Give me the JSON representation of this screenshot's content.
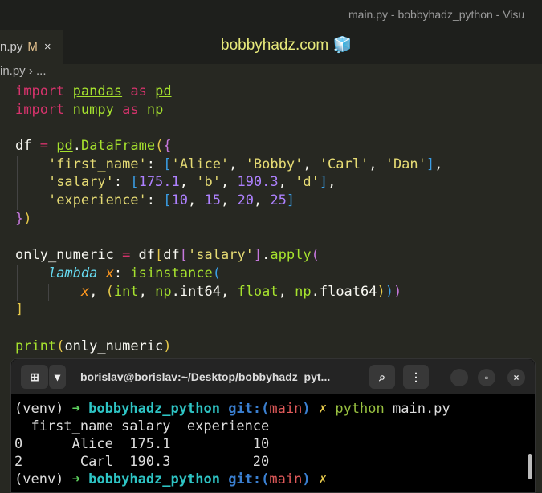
{
  "window": {
    "title": "main.py - bobbyhadz_python - Visu"
  },
  "tab": {
    "name": "n.py",
    "modified": "M",
    "close": "×"
  },
  "brand": {
    "text": "bobbyhadz.com",
    "icon": "🧊"
  },
  "breadcrumb": {
    "text": "in.py › ..."
  },
  "code": [
    [
      [
        "import",
        "kw"
      ],
      " ",
      [
        "pandas",
        "mod"
      ],
      " ",
      [
        "as",
        "kw"
      ],
      " ",
      [
        "pd",
        "mod"
      ]
    ],
    [
      [
        "import",
        "kw"
      ],
      " ",
      [
        "numpy",
        "mod"
      ],
      " ",
      [
        "as",
        "kw"
      ],
      " ",
      [
        "np",
        "mod"
      ]
    ],
    [],
    [
      "df ",
      [
        "=",
        "op"
      ],
      " ",
      [
        "pd",
        "mod"
      ],
      ".",
      [
        "DataFrame",
        "fn"
      ],
      [
        "(",
        "b1"
      ],
      [
        "{",
        "b2"
      ]
    ],
    [
      "    ",
      [
        "'first_name'",
        "str"
      ],
      ": ",
      [
        "[",
        "b3"
      ],
      [
        "'Alice'",
        "str"
      ],
      ", ",
      [
        "'Bobby'",
        "str"
      ],
      ", ",
      [
        "'Carl'",
        "str"
      ],
      ", ",
      [
        "'Dan'",
        "str"
      ],
      [
        "]",
        "b3"
      ],
      ","
    ],
    [
      "    ",
      [
        "'salary'",
        "str"
      ],
      ": ",
      [
        "[",
        "b3"
      ],
      [
        "175.1",
        "num"
      ],
      ", ",
      [
        "'b'",
        "str"
      ],
      ", ",
      [
        "190.3",
        "num"
      ],
      ", ",
      [
        "'d'",
        "str"
      ],
      [
        "]",
        "b3"
      ],
      ","
    ],
    [
      "    ",
      [
        "'experience'",
        "str"
      ],
      ": ",
      [
        "[",
        "b3"
      ],
      [
        "10",
        "num"
      ],
      ", ",
      [
        "15",
        "num"
      ],
      ", ",
      [
        "20",
        "num"
      ],
      ", ",
      [
        "25",
        "num"
      ],
      [
        "]",
        "b3"
      ]
    ],
    [
      [
        "}",
        "b2"
      ],
      [
        ")",
        "b1"
      ]
    ],
    [],
    [
      "only_numeric ",
      [
        "=",
        "op"
      ],
      " df",
      [
        "[",
        "b1"
      ],
      "df",
      [
        "[",
        "b2"
      ],
      [
        "'salary'",
        "str"
      ],
      [
        "]",
        "b2"
      ],
      ".",
      [
        "apply",
        "fn"
      ],
      [
        "(",
        "b2"
      ]
    ],
    [
      "    ",
      [
        "lambda",
        "lam"
      ],
      " ",
      [
        "x",
        "par"
      ],
      ": ",
      [
        "isinstance",
        "fn"
      ],
      [
        "(",
        "b3"
      ]
    ],
    [
      "        ",
      [
        "x",
        "par"
      ],
      ", ",
      [
        "(",
        "b1"
      ],
      [
        "int",
        "mod"
      ],
      ", ",
      [
        "np",
        "mod"
      ],
      ".int64, ",
      [
        "float",
        "mod"
      ],
      ", ",
      [
        "np",
        "mod"
      ],
      ".float64",
      [
        ")",
        "b1"
      ],
      [
        ")",
        "b3"
      ],
      [
        ")",
        "b2"
      ]
    ],
    [
      [
        "]",
        "b1"
      ]
    ],
    [],
    [
      [
        "print",
        "fn"
      ],
      [
        "(",
        "b1"
      ],
      "only_numeric",
      [
        ")",
        "b1"
      ]
    ]
  ],
  "terminal": {
    "title": "borislav@borislav:~/Desktop/bobbyhadz_pyt...",
    "buttons": {
      "minimize": "_",
      "maximize": "▫",
      "close": "×"
    },
    "prompt": {
      "venv": "(venv)",
      "arrow": "➜",
      "dir": "bobbyhadz_python",
      "git": "git:(",
      "branch": "main",
      "git_close": ")",
      "dirty": "✗"
    },
    "command": "python",
    "arg": "main.py",
    "output": [
      "  first_name salary  experience",
      "0      Alice  175.1          10",
      "2       Carl  190.3          20"
    ]
  }
}
